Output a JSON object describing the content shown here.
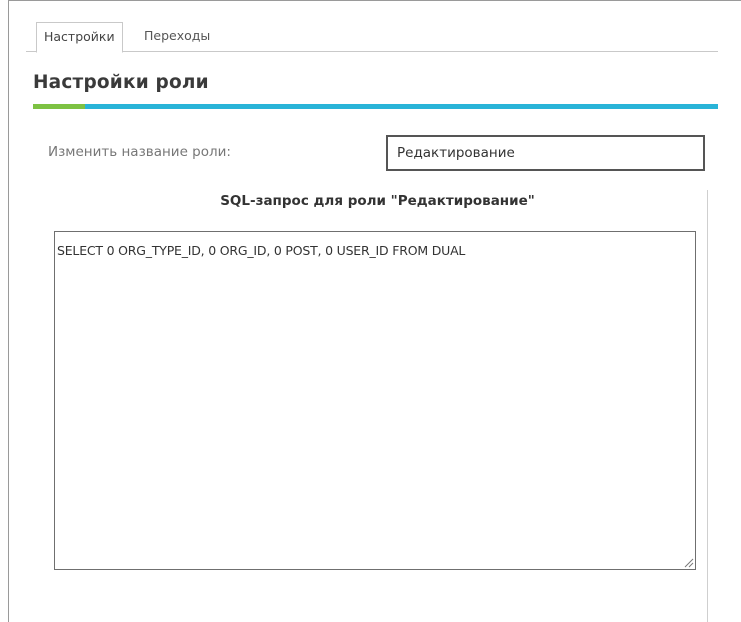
{
  "tabs": [
    {
      "label": "Настройки",
      "active": true
    },
    {
      "label": "Переходы",
      "active": false
    }
  ],
  "section": {
    "title": "Настройки роли"
  },
  "role_name": {
    "label": "Изменить название роли:",
    "value": "Редактирование"
  },
  "sql": {
    "heading": "SQL-запрос для роли \"Редактирование\"",
    "query": "SELECT 0 ORG_TYPE_ID, 0 ORG_ID, 0 POST, 0 USER_ID FROM DUAL"
  },
  "colors": {
    "accent_blue": "#29b4d8",
    "accent_green": "#7dc243"
  },
  "icons": {
    "resize_handle": "resize-grip-icon"
  }
}
